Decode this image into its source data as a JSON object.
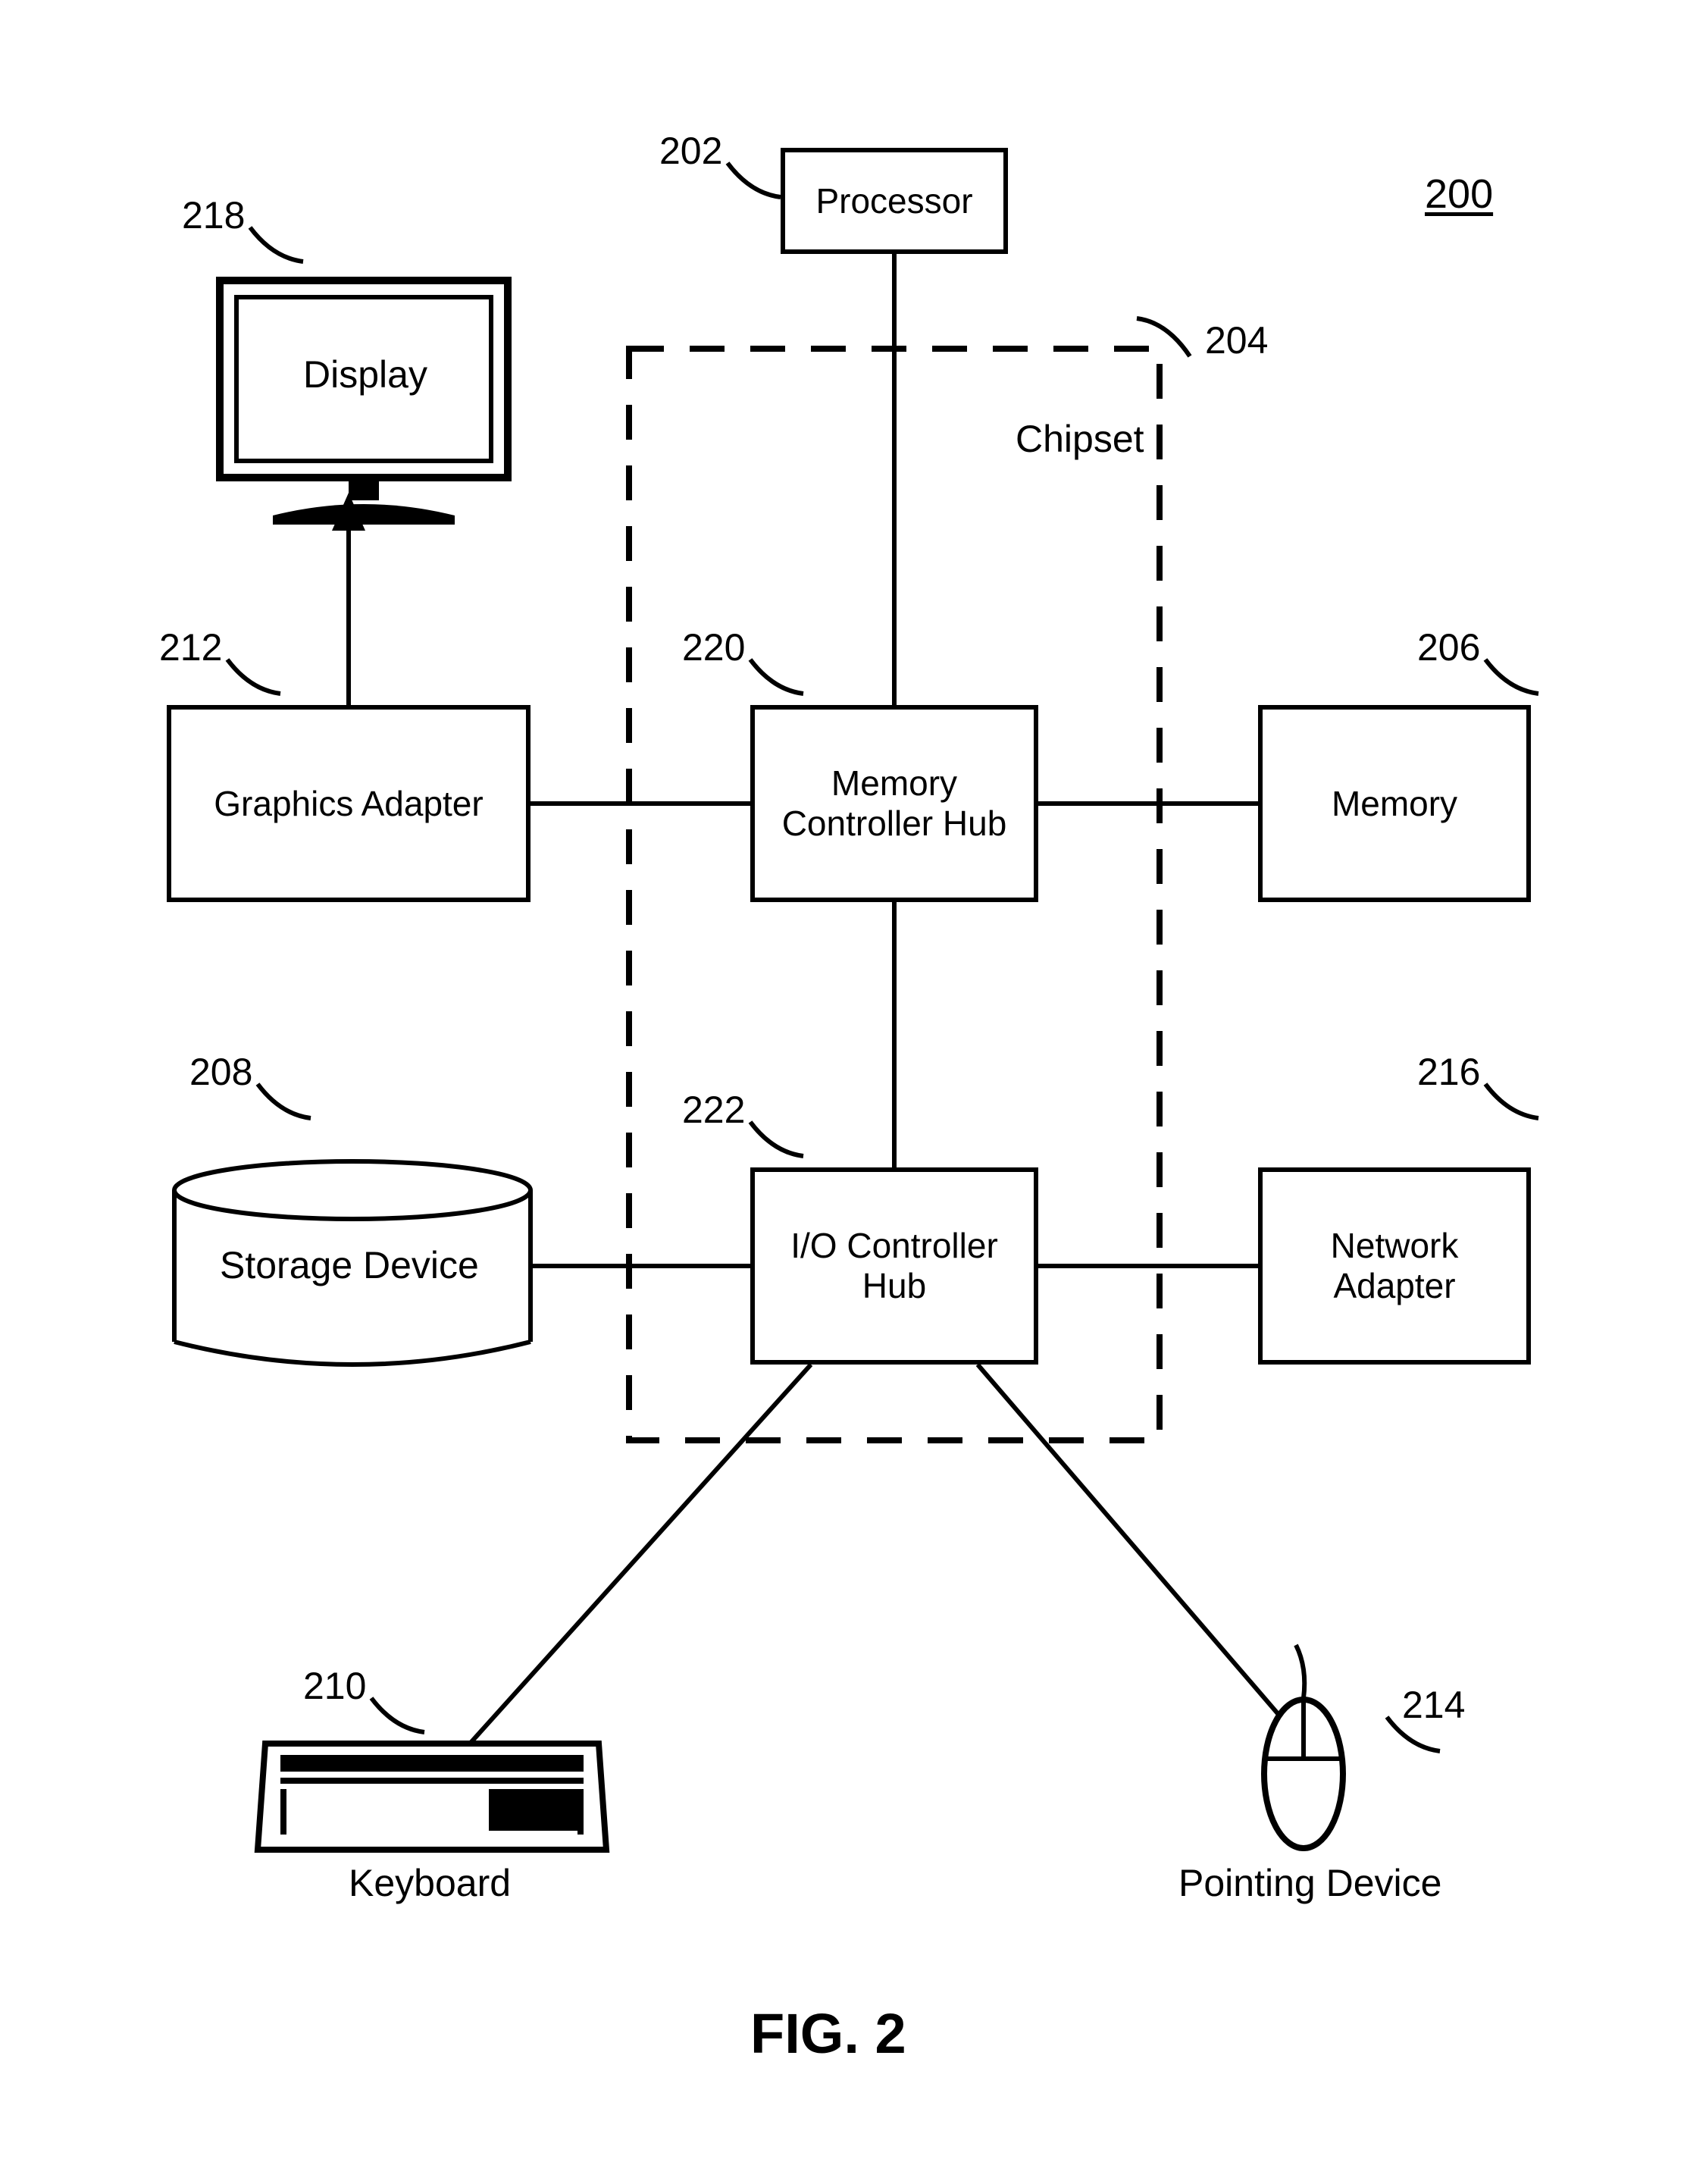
{
  "fig": {
    "number": "200",
    "title": "FIG. 2"
  },
  "blocks": {
    "processor": {
      "ref": "202",
      "text": "Processor"
    },
    "chipset": {
      "ref": "204",
      "text": "Chipset"
    },
    "memory": {
      "ref": "206",
      "text": "Memory"
    },
    "storage": {
      "ref": "208",
      "text": "Storage Device"
    },
    "keyboard": {
      "ref": "210",
      "text": "Keyboard"
    },
    "graphics": {
      "ref": "212",
      "text": "Graphics Adapter"
    },
    "pointing": {
      "ref": "214",
      "text": "Pointing Device"
    },
    "network": {
      "ref": "216",
      "text": "Network\nAdapter"
    },
    "display": {
      "ref": "218",
      "text": "Display"
    },
    "memctl": {
      "ref": "220",
      "text": "Memory\nController Hub"
    },
    "ioctl": {
      "ref": "222",
      "text": "I/O Controller\nHub"
    }
  }
}
